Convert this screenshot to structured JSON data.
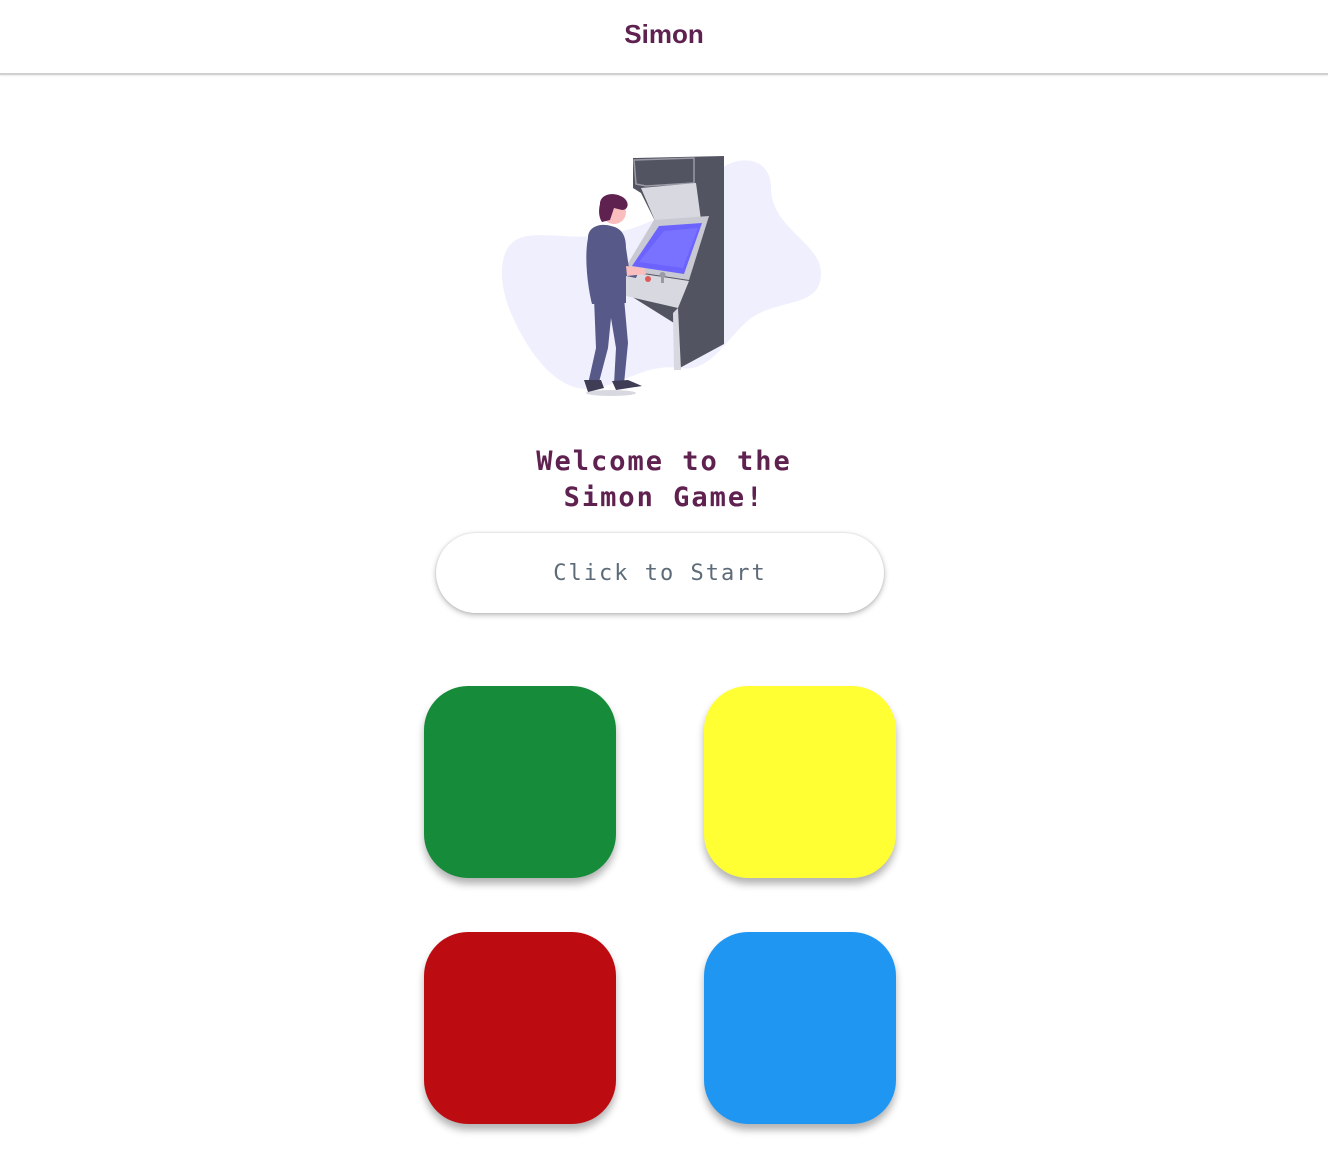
{
  "app": {
    "title": "Simon"
  },
  "hero": {
    "illustration": "person-playing-arcade-machine",
    "welcome_line1": "Welcome to the",
    "welcome_line2": "Simon Game!"
  },
  "controls": {
    "start_label": "Click to Start"
  },
  "pads": [
    {
      "name": "green",
      "color": "#168b3a"
    },
    {
      "name": "yellow",
      "color": "#ffff33"
    },
    {
      "name": "red",
      "color": "#bc0c12"
    },
    {
      "name": "blue",
      "color": "#2096f3"
    }
  ],
  "colors": {
    "accent": "#5e2150",
    "button_text": "#5d6b78"
  }
}
